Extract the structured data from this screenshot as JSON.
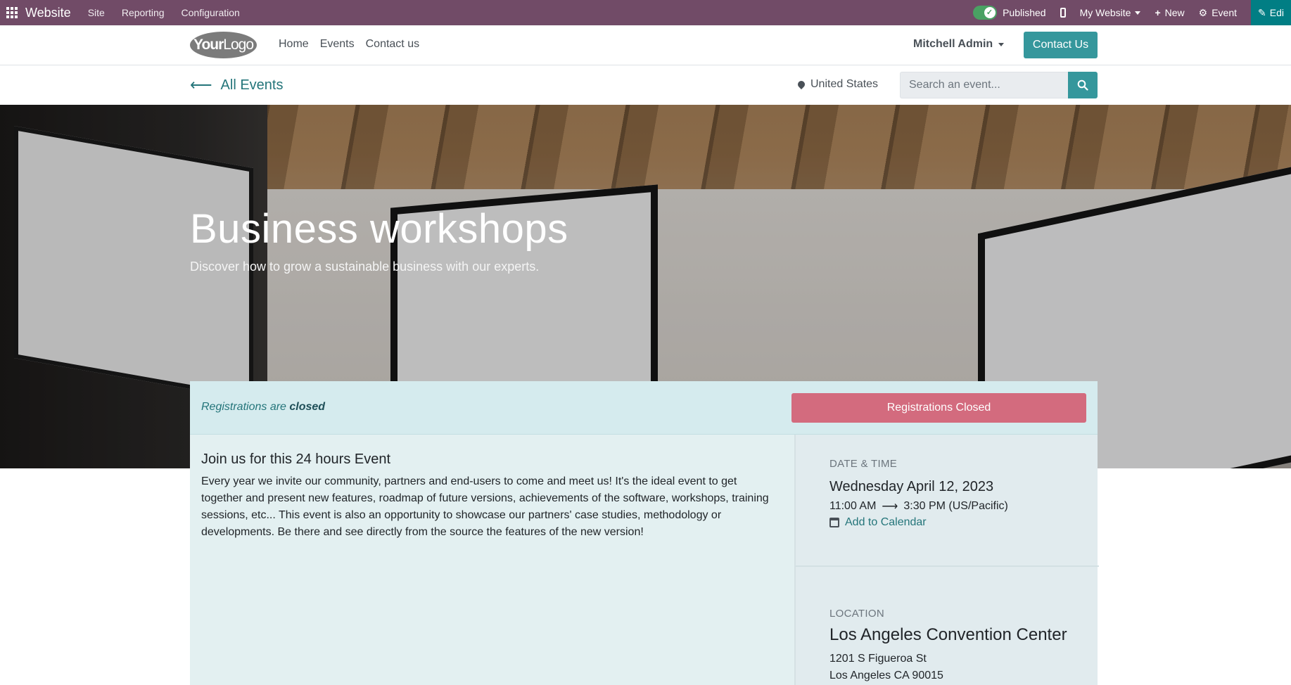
{
  "adminbar": {
    "brand": "Website",
    "menu": [
      "Site",
      "Reporting",
      "Configuration"
    ],
    "published_label": "Published",
    "website_label": "My Website",
    "new_label": "New",
    "event_label": "Event",
    "edit_label": "Edi"
  },
  "header": {
    "logo_bold": "Your",
    "logo_light": "Logo",
    "nav": [
      "Home",
      "Events",
      "Contact us"
    ],
    "user": "Mitchell Admin",
    "contact_button": "Contact Us"
  },
  "subbar": {
    "back_label": "All Events",
    "location": "United States",
    "search_placeholder": "Search an event..."
  },
  "hero": {
    "title": "Business workshops",
    "subtitle": "Discover how to grow a sustainable business with our experts."
  },
  "registration": {
    "status_prefix": "Registrations are ",
    "status_word": "closed",
    "button": "Registrations Closed"
  },
  "content": {
    "heading": "Join us for this 24 hours Event",
    "body": "Every year we invite our community, partners and end-users to come and meet us! It's the ideal event to get together and present new features, roadmap of future versions, achievements of the software, workshops, training sessions, etc... This event is also an opportunity to showcase our partners' case studies, methodology or developments. Be there and see directly from the source the features of the new version!"
  },
  "sidebar": {
    "datetime_label": "DATE & TIME",
    "date": "Wednesday April 12, 2023",
    "time_start": "11:00 AM",
    "time_end": "3:30 PM (US/Pacific)",
    "add_calendar": "Add to Calendar",
    "location_label": "LOCATION",
    "venue": "Los Angeles Convention Center",
    "address_line1": "1201 S Figueroa St",
    "address_line2": "Los Angeles CA 90015"
  },
  "colors": {
    "admin_bar": "#714b67",
    "primary": "#35979c",
    "danger_button": "#d36b7e",
    "link": "#24757a"
  }
}
